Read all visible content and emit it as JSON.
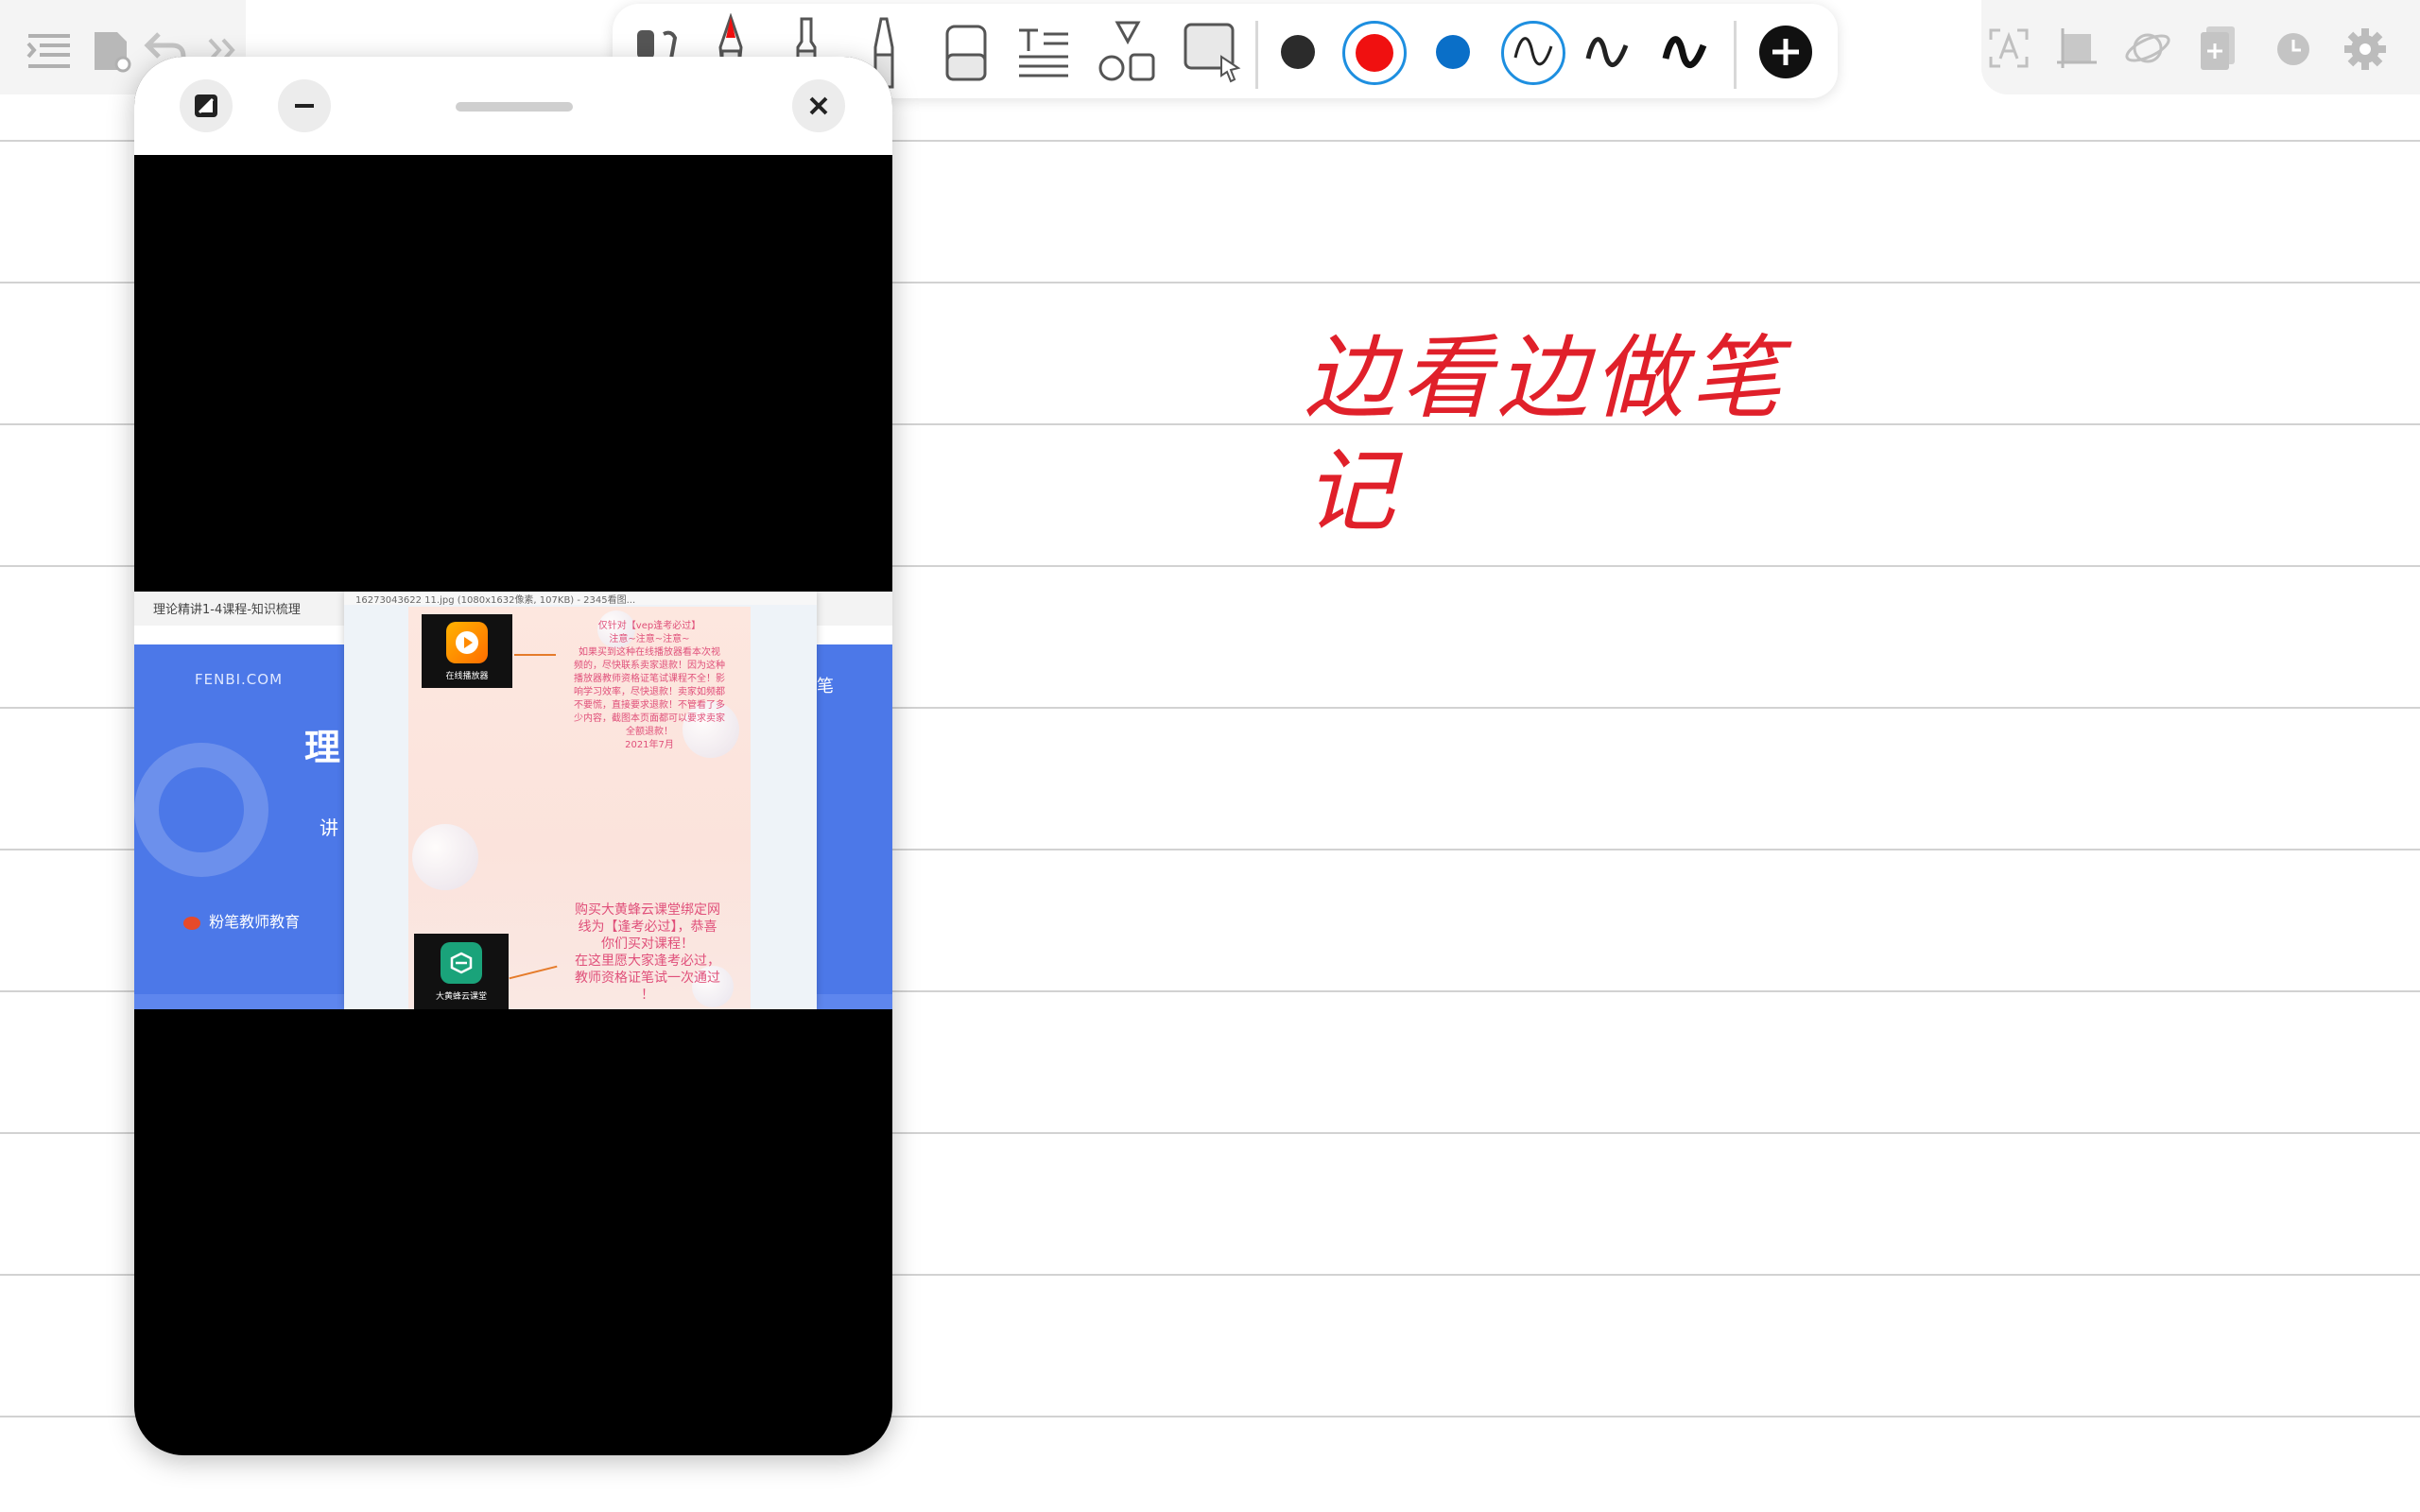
{
  "note": {
    "handwriting": "边看边做笔记",
    "color": "#e0202a"
  },
  "toolbar": {
    "left_icons": [
      "menu-icon",
      "document-sync-icon",
      "undo-icon",
      "expand-icon"
    ],
    "center_tools": [
      "lasso-pointer-icon",
      "fountain-pen-icon",
      "ballpoint-pen-icon",
      "highlighter-icon",
      "eraser-icon",
      "text-tool-icon",
      "shapes-icon",
      "image-select-icon"
    ],
    "colors": [
      "#2b2b2b",
      "#f01010",
      "#0a6fc8"
    ],
    "selected_color": "#f01010",
    "stroke_widths": [
      "thin",
      "medium",
      "thick"
    ],
    "right_icons": [
      "text-recognition-icon",
      "crop-icon",
      "planet-icon",
      "add-page-icon",
      "clock-icon",
      "settings-icon"
    ]
  },
  "float_window": {
    "video": {
      "course_title": "理论精讲1-4课程-知识梳理",
      "site": "FENBI.COM",
      "title_char": "理",
      "subtitle_char": "讲",
      "brand": "粉笔教师教育",
      "right_char": "笔"
    },
    "viewer": {
      "file_bar": "16273043622 11.jpg (1080x1632像素, 107KB) - 2345看图..."
    },
    "poster": {
      "app1_label": "在线播放器",
      "app2_label": "大黄蜂云课堂",
      "top_lines": [
        "仅针对【vep逢考必过】",
        "注意~注意~注意~",
        "如果买到这种在线播放器看本次视",
        "频的，尽快联系卖家退款！因为这种",
        "播放器教师资格证笔试课程不全！影",
        "响学习效率，尽快退款！卖家如频都",
        "不要慌，直接要求退款！不管看了多",
        "少内容，截图本页面都可以要求卖家",
        "全额退款！",
        "2021年7月"
      ],
      "bottom_lines": [
        "购买大黄蜂云课堂绑定网",
        "线为【逢考必过】，恭喜",
        "你们买对课程！",
        "在这里愿大家逢考必过，",
        "教师资格证笔试一次通过",
        "！"
      ]
    }
  }
}
